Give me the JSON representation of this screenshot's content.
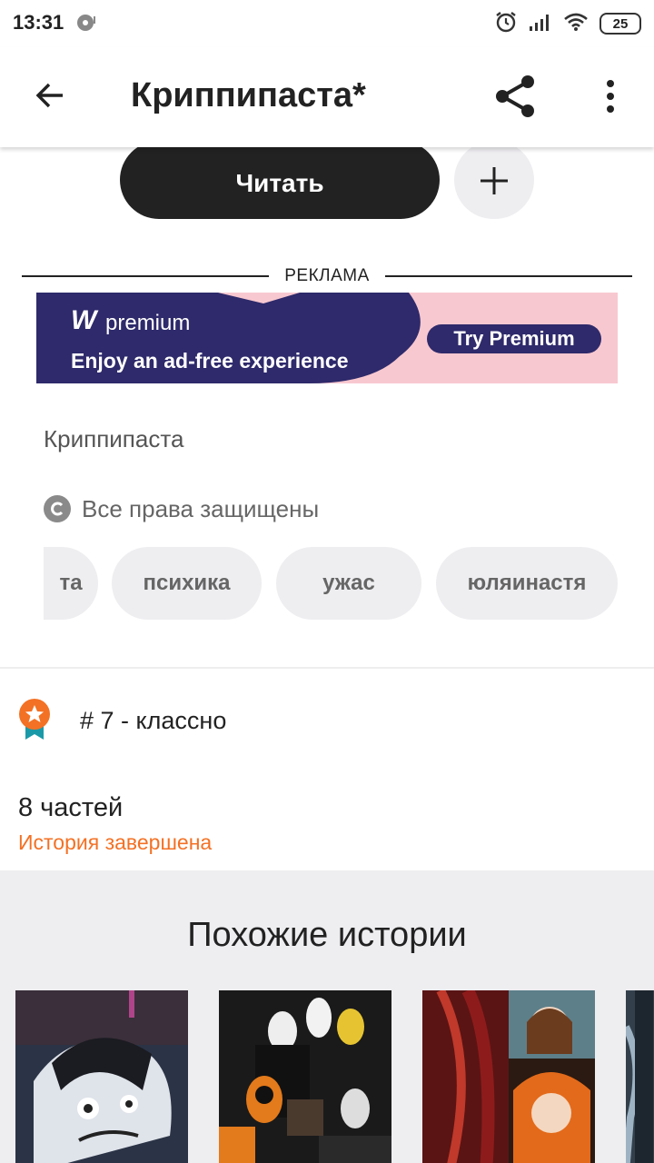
{
  "status_bar": {
    "time": "13:31",
    "battery": "25",
    "icons": [
      "alarm-icon",
      "signal-icon",
      "wifi-icon"
    ]
  },
  "app_bar": {
    "title": "Криппипаста*",
    "back_icon": "arrow-left-icon",
    "share_icon": "share-icon",
    "more_icon": "more-vertical-icon"
  },
  "actions": {
    "read_label": "Читать",
    "add_icon": "plus-icon"
  },
  "ad": {
    "label": "РЕКЛАМА",
    "brand_mark": "W",
    "brand_name": "premium",
    "tagline": "Enjoy an ad-free experience",
    "cta": "Try Premium"
  },
  "details": {
    "story_name": "Криппипаста",
    "copyright": "Все права защищены",
    "tags": [
      "та",
      "психика",
      "ужас",
      "юляинастя"
    ]
  },
  "ranking": {
    "text": "# 7 - классно",
    "icon": "ribbon-badge-icon"
  },
  "parts": {
    "count": "8 частей",
    "status": "История завершена"
  },
  "similar": {
    "title": "Похожие истории",
    "covers": [
      "cover-1",
      "cover-2",
      "cover-3",
      "cover-4"
    ]
  },
  "colors": {
    "accent_orange": "#f37124",
    "dark": "#222222",
    "chip_bg": "#eeedf0",
    "ad_pink": "#f8c8d0",
    "ad_navy": "#2e2a6b"
  }
}
